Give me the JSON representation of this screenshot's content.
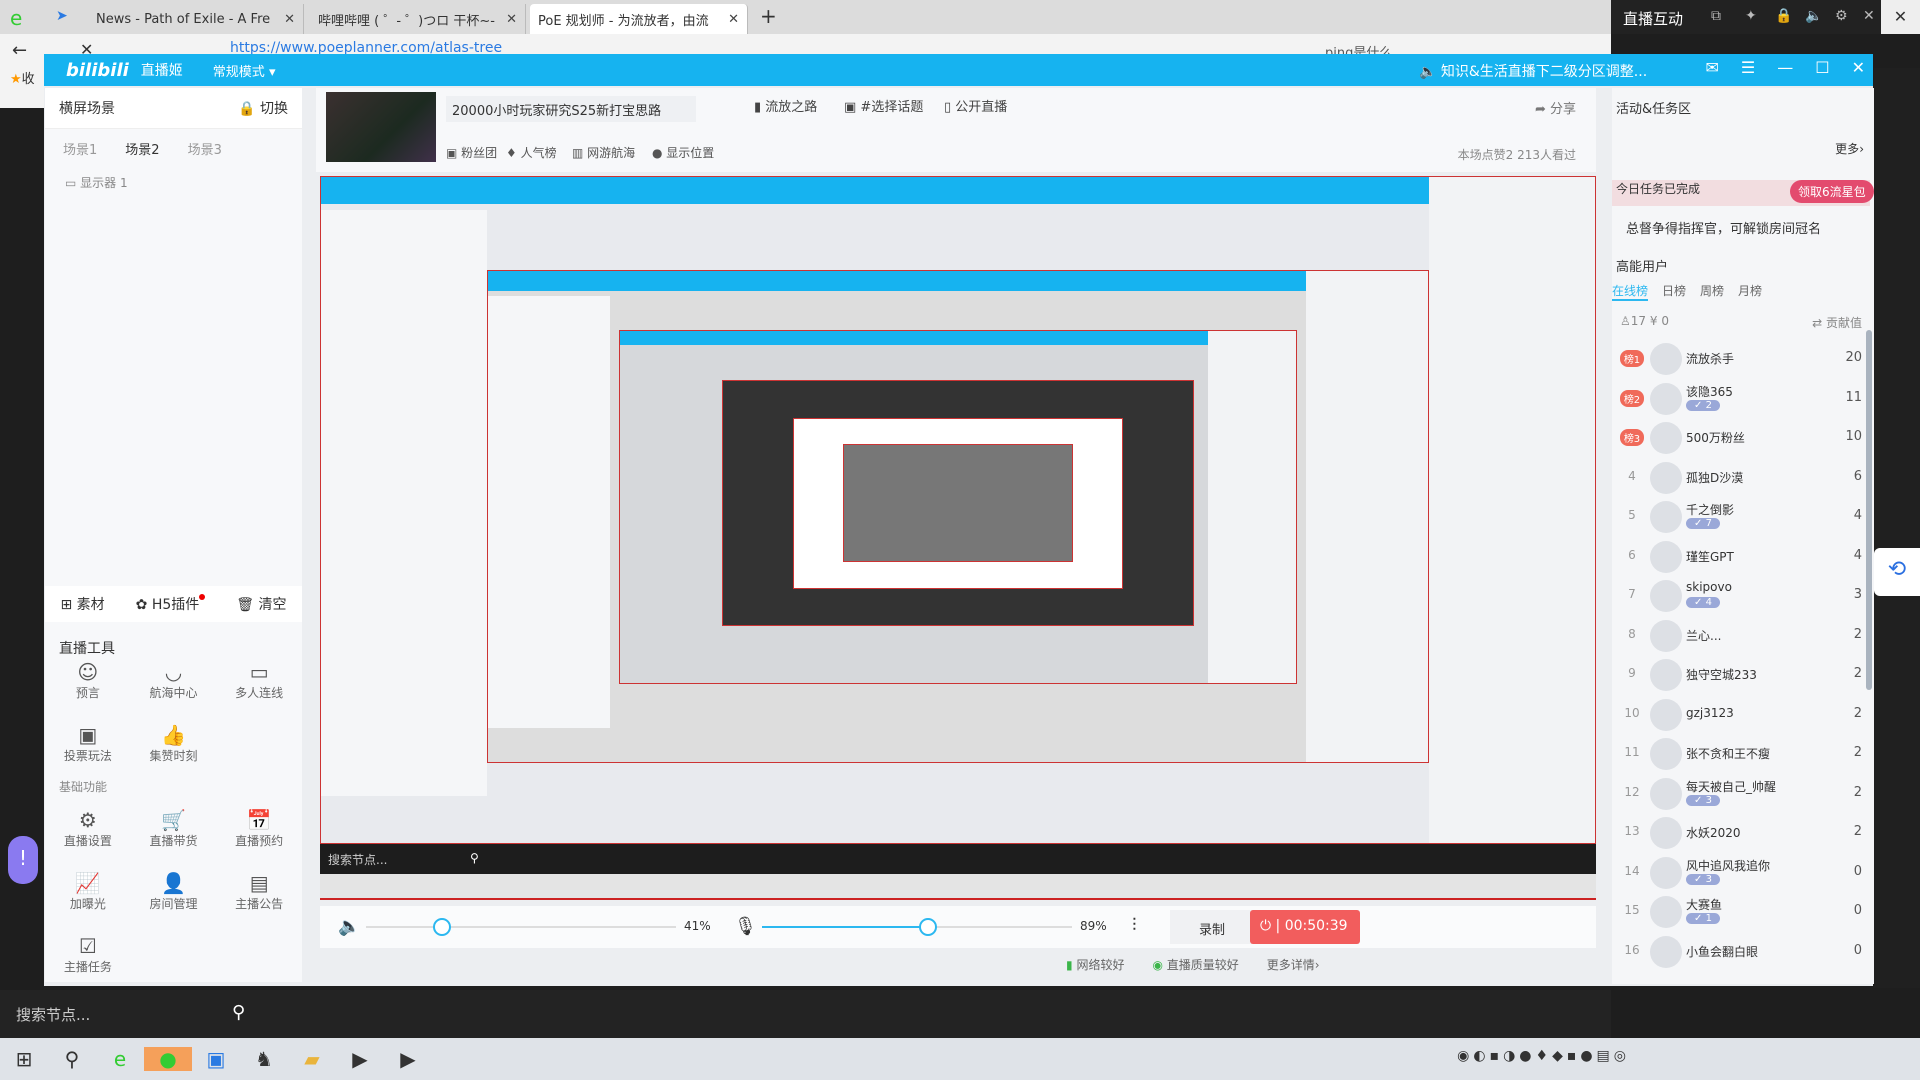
{
  "browser": {
    "tabs": [
      {
        "label": "News - Path of Exile - A Fre"
      },
      {
        "label": "哔哩哔哩 ( ゜- ゜)つロ 干杯~-"
      },
      {
        "label": "PoE 规划师 - 为流放者，由流"
      }
    ],
    "url": "https://www.poeplanner.com/atlas-tree",
    "search": "ping是什么",
    "bookmark": "收"
  },
  "app": {
    "logo": "bilibili",
    "name": "直播姬",
    "mode": "常规模式",
    "notice": "知识&生活直播下二级分区调整...",
    "accent": "#16b3f0"
  },
  "left": {
    "header": "横屏场景",
    "switch": "切换",
    "scenes": [
      "场景1",
      "场景2",
      "场景3"
    ],
    "active_scene": "场景2",
    "monitor": "显示器 1",
    "bar": {
      "material": "素材",
      "h5": "H5插件",
      "clear": "清空"
    },
    "tools_title": "直播工具",
    "tools": [
      "预言",
      "航海中心",
      "多人连线",
      "投票玩法",
      "集赞时刻"
    ],
    "basic_title": "基础功能",
    "basic": [
      "直播设置",
      "直播带货",
      "直播预约",
      "加曝光",
      "房间管理",
      "主播公告",
      "主播任务"
    ]
  },
  "info": {
    "title": "20000小时玩家研究S25新打宝思路",
    "category": "流放之路",
    "topic": "#选择话题",
    "public": "公开直播",
    "fans": "粉丝团",
    "popularity": "人气榜",
    "voyage": "网游航海",
    "location": "显示位置",
    "share": "分享",
    "stats": "本场点赞2  213人看过"
  },
  "preview": {
    "search_placeholder": "搜索节点..."
  },
  "controls": {
    "speaker_volume": 41,
    "speaker_label": "41%",
    "mic_volume": 89,
    "mic_label": "89%",
    "record": "录制",
    "live_time": "00:50:39"
  },
  "status": {
    "network": "网络较好",
    "quality": "直播质量较好",
    "more": "更多详情"
  },
  "chat": {
    "title": "直播互动",
    "activity": "活动&任务区",
    "more": "更多",
    "task_done": "今日任务已完成",
    "pkg": "领取6流星包",
    "commander": "总督争得指挥官，可解锁房间冠名",
    "high_energy": "高能用户",
    "tabs": [
      "在线榜",
      "日榜",
      "周榜",
      "月榜"
    ],
    "online": "17",
    "coins": "¥ 0",
    "contrib": "贡献值",
    "ranks": [
      {
        "rank": "榜1",
        "name": "流放杀手",
        "score": "20",
        "lv": ""
      },
      {
        "rank": "榜2",
        "name": "该隐365",
        "score": "11",
        "lv": "2"
      },
      {
        "rank": "榜3",
        "name": "500万粉丝",
        "score": "10",
        "lv": ""
      },
      {
        "rank": "4",
        "name": "孤独D沙漠",
        "score": "6",
        "lv": ""
      },
      {
        "rank": "5",
        "name": "千之倒影",
        "score": "4",
        "lv": "7"
      },
      {
        "rank": "6",
        "name": "瑾笙GPT",
        "score": "4",
        "lv": ""
      },
      {
        "rank": "7",
        "name": "skipovo",
        "score": "3",
        "lv": "4"
      },
      {
        "rank": "8",
        "name": "兰心...",
        "score": "2",
        "lv": ""
      },
      {
        "rank": "9",
        "name": "独守空城233",
        "score": "2",
        "lv": ""
      },
      {
        "rank": "10",
        "name": "gzj3123",
        "score": "2",
        "lv": ""
      },
      {
        "rank": "11",
        "name": "张不贪和王不瘦",
        "score": "2",
        "lv": ""
      },
      {
        "rank": "12",
        "name": "每天被自己_帅醒",
        "score": "2",
        "lv": "3"
      },
      {
        "rank": "13",
        "name": "水妖2020",
        "score": "2",
        "lv": ""
      },
      {
        "rank": "14",
        "name": "风中追风我追你",
        "score": "0",
        "lv": "3"
      },
      {
        "rank": "15",
        "name": "大赛鱼",
        "score": "0",
        "lv": "1"
      },
      {
        "rank": "16",
        "name": "小鱼会翻白眼",
        "score": "0",
        "lv": ""
      }
    ]
  },
  "bottom": {
    "search_placeholder": "搜索节点..."
  }
}
